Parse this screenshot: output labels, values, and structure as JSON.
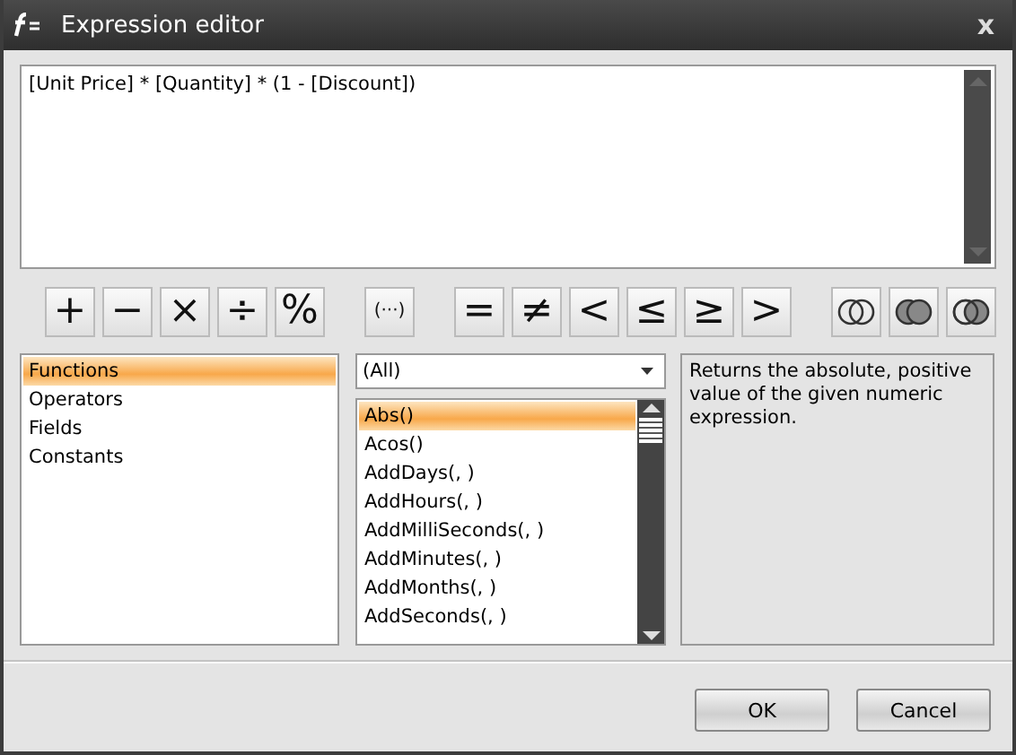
{
  "window": {
    "title": "Expression editor",
    "close": "x"
  },
  "expression": {
    "value": "[Unit Price] * [Quantity] * (1 - [Discount])"
  },
  "toolbar": [
    {
      "buttons": [
        {
          "kind": "text",
          "label": "+"
        },
        {
          "kind": "text",
          "label": "−"
        },
        {
          "kind": "text",
          "label": "×"
        },
        {
          "kind": "text",
          "label": "÷"
        },
        {
          "kind": "text",
          "label": "%"
        }
      ]
    },
    {
      "buttons": [
        {
          "kind": "text",
          "label": "(···)"
        }
      ]
    },
    {
      "buttons": [
        {
          "kind": "text",
          "label": "="
        },
        {
          "kind": "text",
          "label": "≠"
        },
        {
          "kind": "text",
          "label": "<"
        },
        {
          "kind": "text",
          "label": "≤"
        },
        {
          "kind": "text",
          "label": "≥"
        },
        {
          "kind": "text",
          "label": ">"
        }
      ]
    },
    {
      "buttons": [
        {
          "kind": "venn_outline"
        },
        {
          "kind": "venn_filled"
        },
        {
          "kind": "venn_right"
        }
      ]
    }
  ],
  "categories": [
    {
      "label": "Functions",
      "selected": true
    },
    {
      "label": "Operators",
      "selected": false
    },
    {
      "label": "Fields",
      "selected": false
    },
    {
      "label": "Constants",
      "selected": false
    }
  ],
  "filter": {
    "value": "(All)"
  },
  "functions": [
    {
      "label": "Abs()",
      "selected": true
    },
    {
      "label": "Acos()",
      "selected": false
    },
    {
      "label": "AddDays(, )",
      "selected": false
    },
    {
      "label": "AddHours(, )",
      "selected": false
    },
    {
      "label": "AddMilliSeconds(, )",
      "selected": false
    },
    {
      "label": "AddMinutes(, )",
      "selected": false
    },
    {
      "label": "AddMonths(, )",
      "selected": false
    },
    {
      "label": "AddSeconds(, )",
      "selected": false
    }
  ],
  "description": "Returns the absolute, positive value of the given numeric expression.",
  "buttons": [
    {
      "label": "OK"
    },
    {
      "label": "Cancel"
    }
  ]
}
